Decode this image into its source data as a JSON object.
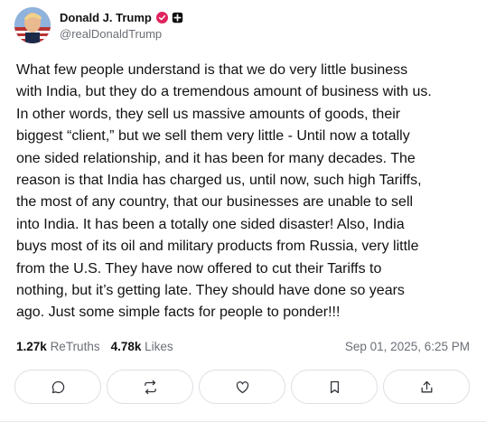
{
  "author": {
    "display_name": "Donald J. Trump",
    "handle": "@realDonaldTrump",
    "avatar_icon": "profile-photo",
    "verified_color": "#e0245e"
  },
  "post": {
    "text": "What few people understand is that we do very little business\nwith India, but they do a tremendous amount of business with us.\nIn other words, they sell us massive amounts of goods, their\nbiggest “client,” but we sell them very little - Until now a totally\none sided relationship, and it has been for many decades. The\nreason is that India has charged us, until now, such high Tariffs,\nthe most of any country, that our businesses are unable to sell\ninto India. It has been a totally one sided disaster! Also, India\nbuys most of its oil and military products from Russia, very little\nfrom the U.S. They have now offered to cut their Tariffs to\nnothing, but it’s getting late. They should have done so years\nago. Just some simple facts for people to ponder!!!"
  },
  "stats": {
    "retruths_count": "1.27k",
    "retruths_label": "ReTruths",
    "likes_count": "4.78k",
    "likes_label": "Likes",
    "timestamp": "Sep 01, 2025, 6:25 PM"
  },
  "actions": [
    {
      "icon": "reply-icon"
    },
    {
      "icon": "retruth-icon"
    },
    {
      "icon": "like-icon"
    },
    {
      "icon": "bookmark-icon"
    },
    {
      "icon": "share-icon"
    }
  ]
}
